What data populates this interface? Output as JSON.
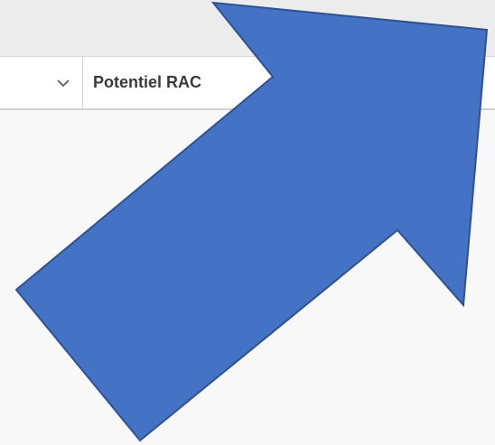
{
  "table": {
    "column_header": {
      "label": "Potentiel RAC",
      "dropdown_icon": "chevron-down-icon"
    }
  },
  "overlay": {
    "arrow_icon": "arrow-up-right-icon",
    "arrow_color": "#4472c4",
    "arrow_outline_color": "#2f528f"
  }
}
